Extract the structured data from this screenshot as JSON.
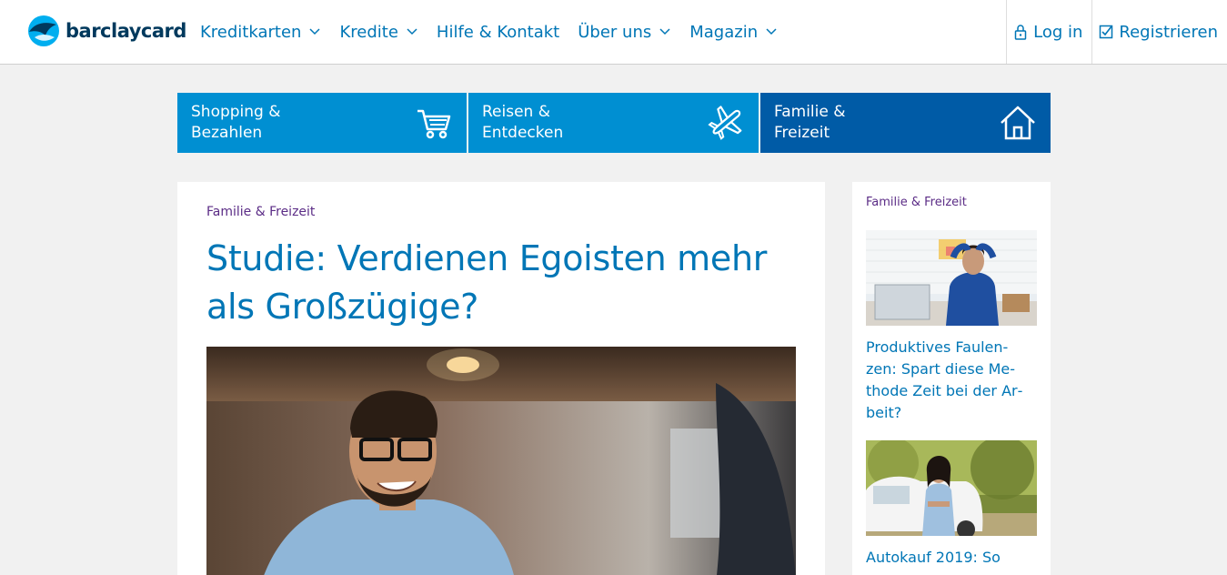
{
  "header": {
    "logo_text": "barclaycard",
    "nav": [
      {
        "label": "Kreditkarten",
        "has_dropdown": true
      },
      {
        "label": "Kredite",
        "has_dropdown": true
      },
      {
        "label": "Hilfe & Kontakt",
        "has_dropdown": false
      },
      {
        "label": "Über uns",
        "has_dropdown": true
      },
      {
        "label": "Magazin",
        "has_dropdown": true
      }
    ],
    "login_label": "Log in",
    "register_label": "Registrieren"
  },
  "tiles": [
    {
      "line1": "Shopping &",
      "line2": "Bezahlen",
      "icon": "shopping-cart-icon"
    },
    {
      "line1": "Reisen &",
      "line2": "Entdecken",
      "icon": "airplane-icon"
    },
    {
      "line1": "Familie &",
      "line2": "Freizeit",
      "icon": "house-icon"
    }
  ],
  "article": {
    "category": "Familie & Freizeit",
    "title": "Studie: Verdienen Egoisten mehr als Großzügige?"
  },
  "sidebar": {
    "category": "Familie & Freizeit",
    "items": [
      {
        "title": "Produktives Faulen­zen: Spart diese Me­thode Zeit bei der Ar­beit?"
      },
      {
        "title": "Autokauf 2019: So"
      }
    ]
  },
  "colors": {
    "brand_blue": "#0076b6",
    "tile_light": "#008fd2",
    "tile_dark": "#005ba6",
    "category_purple": "#5b2c86",
    "background": "#f1f1f1"
  }
}
